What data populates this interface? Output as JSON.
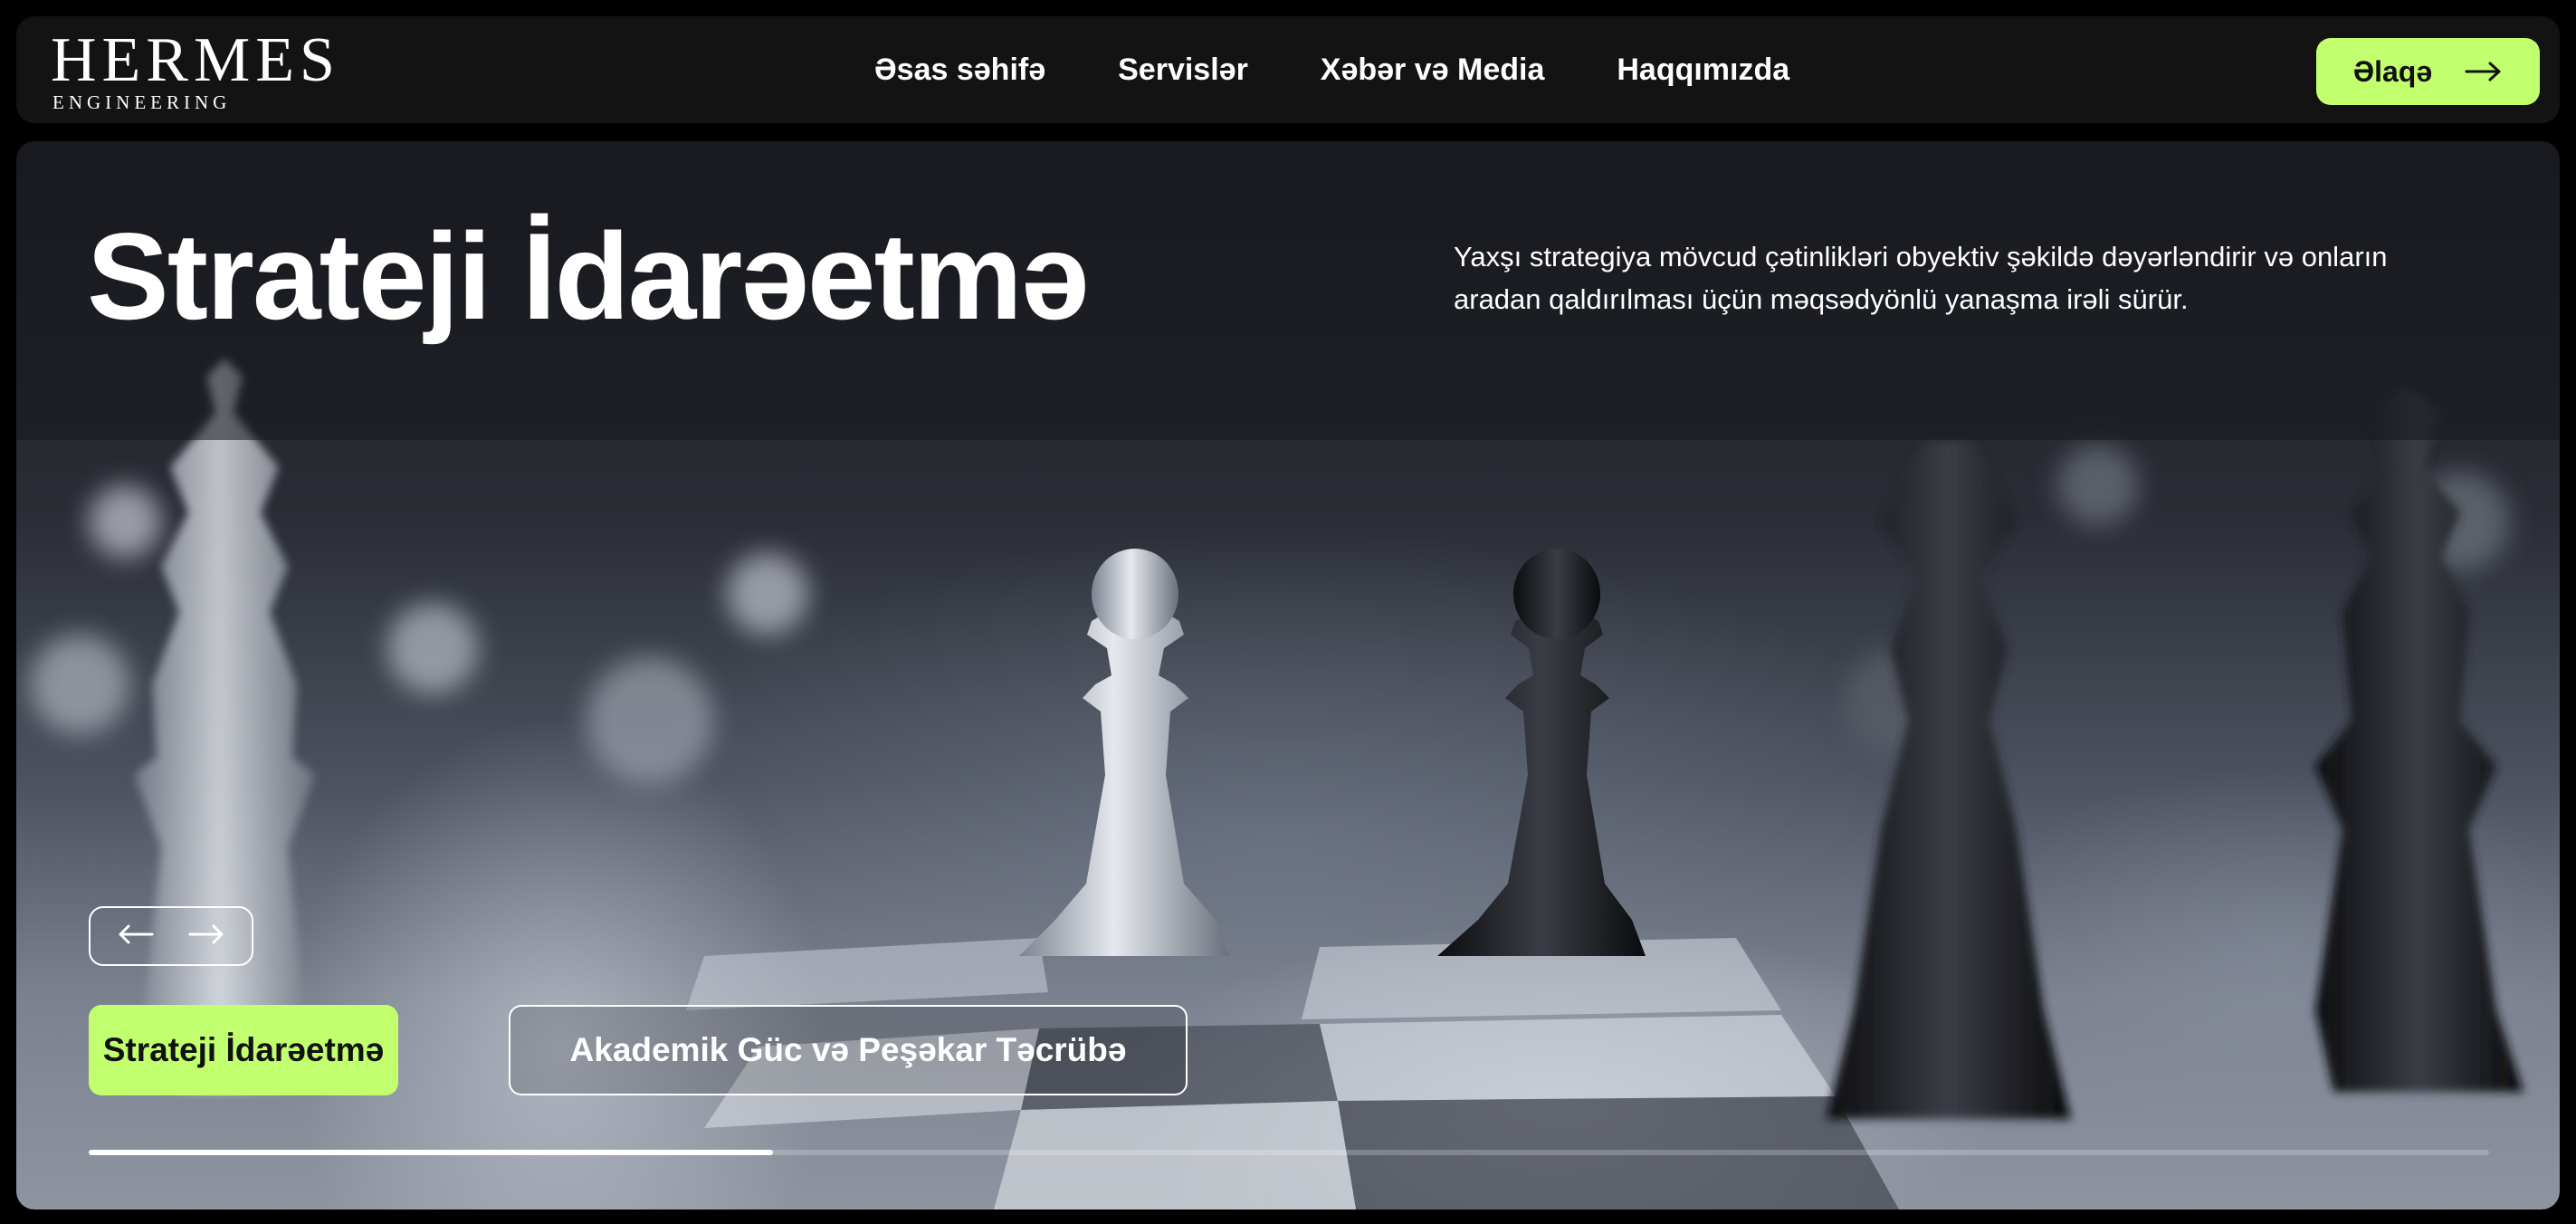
{
  "brand": {
    "name": "HERMES",
    "tagline": "ENGINEERING"
  },
  "nav": {
    "links": [
      "Əsas səhifə",
      "Servislər",
      "Xəbər və Media",
      "Haqqımızda"
    ],
    "contact_label": "Əlaqə"
  },
  "hero": {
    "title": "Strateji İdarəetmə",
    "description": "Yaxşı strategiya mövcud çətinlikləri obyektiv şəkildə dəyərləndirir və onların aradan qaldırılması üçün məqsədyönlü yanaşma irəli sürür.",
    "slides": [
      "Strateji İdarəetmə",
      "Akademik Güc və Peşəkar Təcrübə"
    ],
    "active_slide": 0,
    "progress": 0.285
  },
  "colors": {
    "accent": "#c2ff6e",
    "nav_bg": "#131313",
    "text": "#ffffff"
  },
  "icons": {
    "contact": "arrow-right-icon",
    "prev": "arrow-left-icon",
    "next": "arrow-right-icon"
  }
}
